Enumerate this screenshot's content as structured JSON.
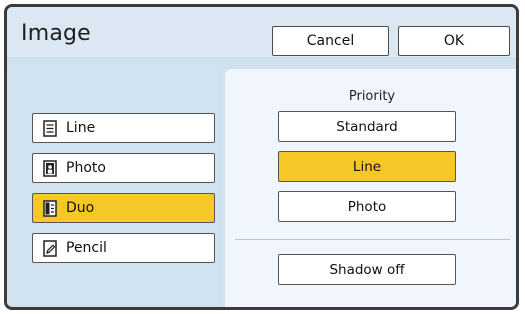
{
  "dialog": {
    "title": "Image"
  },
  "header": {
    "cancel_label": "Cancel",
    "ok_label": "OK"
  },
  "modes": [
    {
      "label": "Line",
      "icon": "line-doc-icon",
      "selected": false
    },
    {
      "label": "Photo",
      "icon": "photo-doc-icon",
      "selected": false
    },
    {
      "label": "Duo",
      "icon": "duo-doc-icon",
      "selected": true
    },
    {
      "label": "Pencil",
      "icon": "pencil-doc-icon",
      "selected": false
    }
  ],
  "priority": {
    "label": "Priority",
    "options": [
      {
        "label": "Standard",
        "selected": false
      },
      {
        "label": "Line",
        "selected": true
      },
      {
        "label": "Photo",
        "selected": false
      }
    ]
  },
  "shadow": {
    "label": "Shadow off"
  },
  "colors": {
    "selected": "#f5c828",
    "panel": "#cfe0ee",
    "right_panel": "#f0f6fb"
  }
}
